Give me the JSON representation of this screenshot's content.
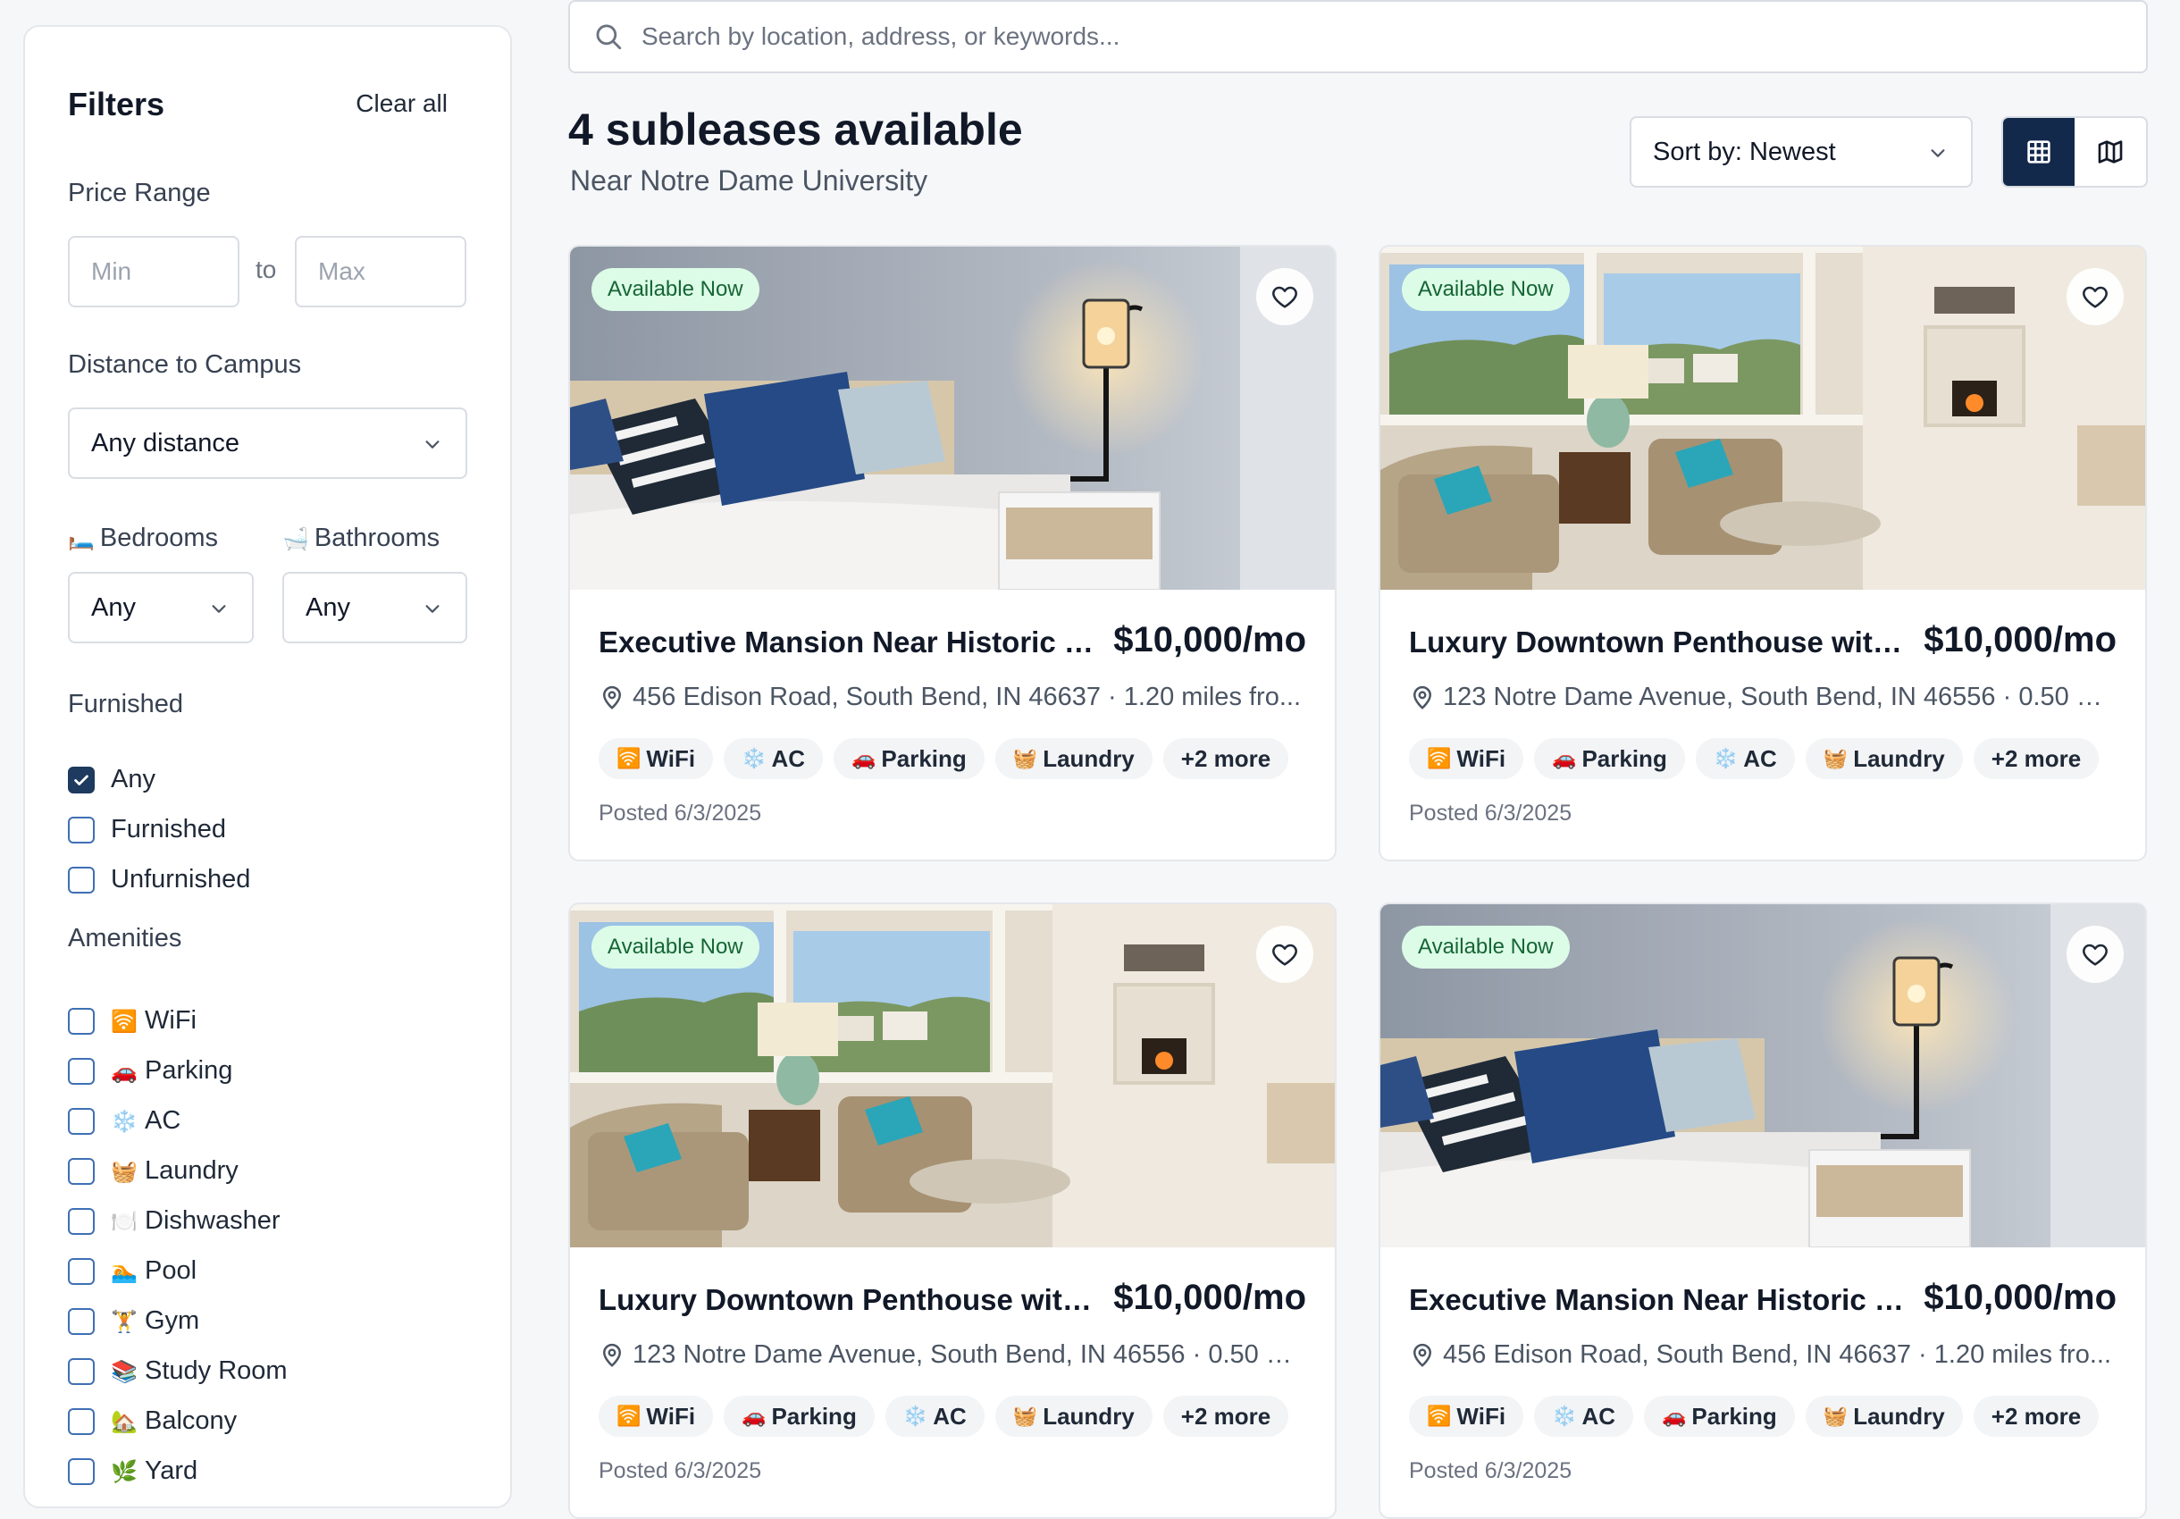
{
  "search": {
    "placeholder": "Search by location, address, or keywords..."
  },
  "filters": {
    "title": "Filters",
    "clear_all": "Clear all",
    "price_label": "Price Range",
    "min_placeholder": "Min",
    "max_placeholder": "Max",
    "to": "to",
    "distance_label": "Distance to Campus",
    "distance_value": "Any distance",
    "bedrooms_emoji": "🛏️",
    "bedrooms_label": "Bedrooms",
    "bathrooms_emoji": "🛁",
    "bathrooms_label": "Bathrooms",
    "bedrooms_value": "Any",
    "bathrooms_value": "Any",
    "furnished_label": "Furnished",
    "furnished_options": [
      {
        "label": "Any",
        "checked": true
      },
      {
        "label": "Furnished",
        "checked": false
      },
      {
        "label": "Unfurnished",
        "checked": false
      }
    ],
    "amenities_label": "Amenities",
    "amenities": [
      {
        "emoji": "🛜",
        "label": "WiFi"
      },
      {
        "emoji": "🚗",
        "label": "Parking"
      },
      {
        "emoji": "❄️",
        "label": "AC"
      },
      {
        "emoji": "🧺",
        "label": "Laundry"
      },
      {
        "emoji": "🍽️",
        "label": "Dishwasher"
      },
      {
        "emoji": "🏊",
        "label": "Pool"
      },
      {
        "emoji": "🏋️",
        "label": "Gym"
      },
      {
        "emoji": "📚",
        "label": "Study Room"
      },
      {
        "emoji": "🏡",
        "label": "Balcony"
      },
      {
        "emoji": "🌿",
        "label": "Yard"
      }
    ]
  },
  "results": {
    "title": "4 subleases available",
    "subtitle": "Near Notre Dame University",
    "sort_label": "Sort by: Newest"
  },
  "listings": [
    {
      "badge": "Available Now",
      "title": "Executive Mansion Near Historic C...",
      "price": "$10,000/mo",
      "address": "456 Edison Road, South Bend, IN 46637 · 1.20 miles fro...",
      "tags": [
        {
          "emoji": "🛜",
          "label": "WiFi"
        },
        {
          "emoji": "❄️",
          "label": "AC"
        },
        {
          "emoji": "🚗",
          "label": "Parking"
        },
        {
          "emoji": "🧺",
          "label": "Laundry"
        },
        {
          "emoji": "",
          "label": "+2 more"
        }
      ],
      "posted": "Posted 6/3/2025",
      "image": "bedroom"
    },
    {
      "badge": "Available Now",
      "title": "Luxury Downtown Penthouse with ...",
      "price": "$10,000/mo",
      "address": "123 Notre Dame Avenue, South Bend, IN 46556 · 0.50 mi...",
      "tags": [
        {
          "emoji": "🛜",
          "label": "WiFi"
        },
        {
          "emoji": "🚗",
          "label": "Parking"
        },
        {
          "emoji": "❄️",
          "label": "AC"
        },
        {
          "emoji": "🧺",
          "label": "Laundry"
        },
        {
          "emoji": "",
          "label": "+2 more"
        }
      ],
      "posted": "Posted 6/3/2025",
      "image": "living"
    },
    {
      "badge": "Available Now",
      "title": "Luxury Downtown Penthouse with ...",
      "price": "$10,000/mo",
      "address": "123 Notre Dame Avenue, South Bend, IN 46556 · 0.50 mi...",
      "tags": [
        {
          "emoji": "🛜",
          "label": "WiFi"
        },
        {
          "emoji": "🚗",
          "label": "Parking"
        },
        {
          "emoji": "❄️",
          "label": "AC"
        },
        {
          "emoji": "🧺",
          "label": "Laundry"
        },
        {
          "emoji": "",
          "label": "+2 more"
        }
      ],
      "posted": "Posted 6/3/2025",
      "image": "living"
    },
    {
      "badge": "Available Now",
      "title": "Executive Mansion Near Historic C...",
      "price": "$10,000/mo",
      "address": "456 Edison Road, South Bend, IN 46637 · 1.20 miles fro...",
      "tags": [
        {
          "emoji": "🛜",
          "label": "WiFi"
        },
        {
          "emoji": "❄️",
          "label": "AC"
        },
        {
          "emoji": "🚗",
          "label": "Parking"
        },
        {
          "emoji": "🧺",
          "label": "Laundry"
        },
        {
          "emoji": "",
          "label": "+2 more"
        }
      ],
      "posted": "Posted 6/3/2025",
      "image": "bedroom"
    }
  ]
}
